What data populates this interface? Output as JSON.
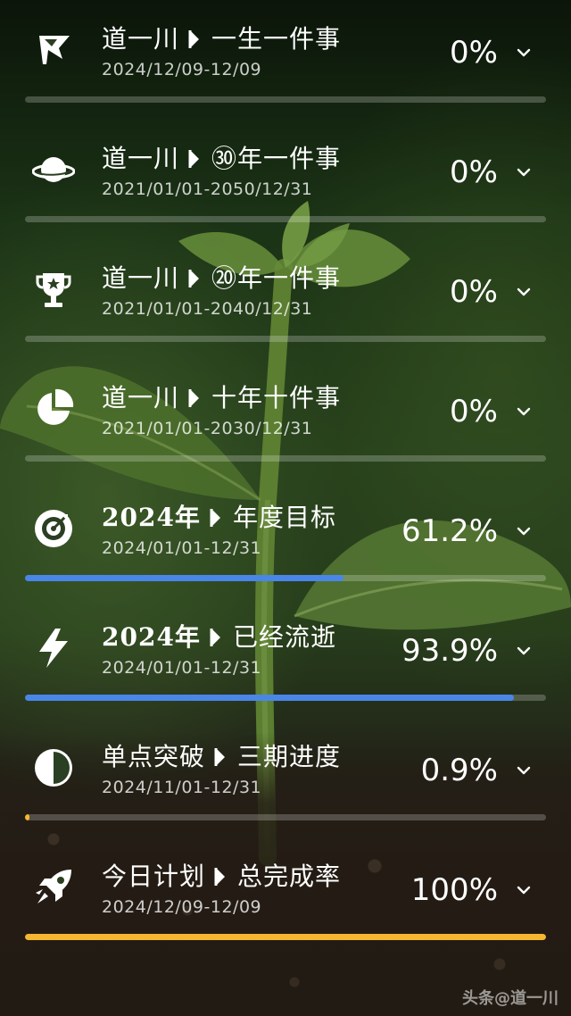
{
  "items": [
    {
      "icon": "flag-icon",
      "prefix": "道一川",
      "prefix_strong": false,
      "suffix": "一生一件事",
      "date": "2024/12/09-12/09",
      "percent": "0%",
      "progress": 0,
      "bar_color": "#4a86e8"
    },
    {
      "icon": "planet-icon",
      "prefix": "道一川",
      "prefix_strong": false,
      "suffix": "㉚年一件事",
      "date": "2021/01/01-2050/12/31",
      "percent": "0%",
      "progress": 0,
      "bar_color": "#4a86e8"
    },
    {
      "icon": "trophy-icon",
      "prefix": "道一川",
      "prefix_strong": false,
      "suffix": "⑳年一件事",
      "date": "2021/01/01-2040/12/31",
      "percent": "0%",
      "progress": 0,
      "bar_color": "#4a86e8"
    },
    {
      "icon": "pie-chart-icon",
      "prefix": "道一川",
      "prefix_strong": false,
      "suffix": "十年十件事",
      "date": "2021/01/01-2030/12/31",
      "percent": "0%",
      "progress": 0,
      "bar_color": "#4a86e8"
    },
    {
      "icon": "target-icon",
      "prefix": "2024年",
      "prefix_strong": true,
      "suffix": "年度目标",
      "date": "2024/01/01-12/31",
      "percent": "61.2%",
      "progress": 0.612,
      "bar_color": "#4a86e8"
    },
    {
      "icon": "lightning-icon",
      "prefix": "2024年",
      "prefix_strong": true,
      "suffix": "已经流逝",
      "date": "2024/01/01-12/31",
      "percent": "93.9%",
      "progress": 0.939,
      "bar_color": "#4a86e8"
    },
    {
      "icon": "half-circle-icon",
      "prefix": "单点突破",
      "prefix_strong": false,
      "suffix": "三期进度",
      "date": "2024/11/01-12/31",
      "percent": "0.9%",
      "progress": 0.009,
      "bar_color": "#f5b731"
    },
    {
      "icon": "rocket-icon",
      "prefix": "今日计划",
      "prefix_strong": false,
      "suffix": "总完成率",
      "date": "2024/12/09-12/09",
      "percent": "100%",
      "progress": 1.0,
      "bar_color": "#f5b731"
    }
  ],
  "watermark": "头条@道一川"
}
